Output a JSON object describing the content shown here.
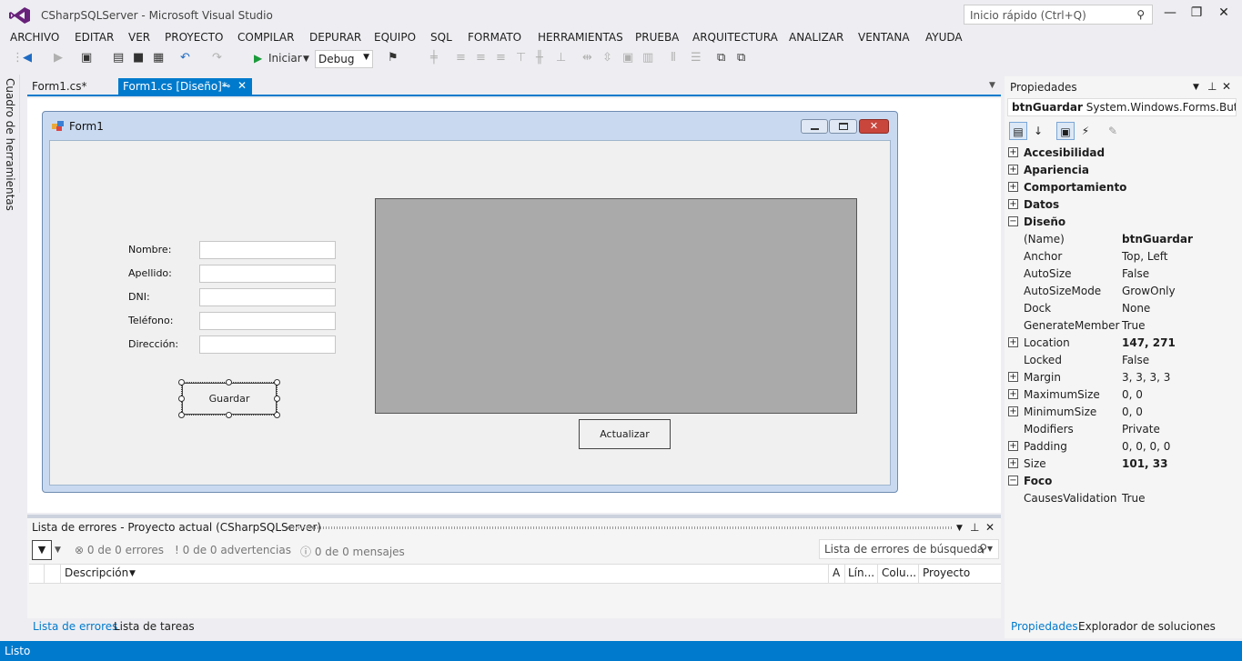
{
  "window": {
    "title": "CSharpSQLServer - Microsoft Visual Studio",
    "quick_launch_placeholder": "Inicio rápido (Ctrl+Q)"
  },
  "menu": [
    "ARCHIVO",
    "EDITAR",
    "VER",
    "PROYECTO",
    "COMPILAR",
    "DEPURAR",
    "EQUIPO",
    "SQL",
    "FORMATO",
    "HERRAMIENTAS",
    "PRUEBA",
    "ARQUITECTURA",
    "ANALIZAR",
    "VENTANA",
    "AYUDA"
  ],
  "toolbar": {
    "start_label": "Iniciar",
    "config": "Debug"
  },
  "toolbox": {
    "label": "Cuadro de herramientas"
  },
  "tabs": [
    {
      "label": "Form1.cs*"
    },
    {
      "label": "Form1.cs [Diseño]*"
    }
  ],
  "form": {
    "title": "Form1",
    "fields": [
      {
        "label": "Nombre:",
        "value": ""
      },
      {
        "label": "Apellido:",
        "value": ""
      },
      {
        "label": "DNI:",
        "value": ""
      },
      {
        "label": "Teléfono:",
        "value": ""
      },
      {
        "label": "Dirección:",
        "value": ""
      }
    ],
    "save_button": "Guardar",
    "refresh_button": "Actualizar"
  },
  "error_list": {
    "title": "Lista de errores - Proyecto actual (CSharpSQLServer)",
    "errors": "0 de 0 errores",
    "warnings": "0 de 0 advertencias",
    "messages": "0 de 0 mensajes",
    "search_placeholder": "Lista de errores de búsqueda",
    "columns": [
      "Descripción",
      "A",
      "Lín...",
      "Colu...",
      "Proyecto"
    ],
    "tabs": [
      "Lista de errores",
      "Lista de tareas"
    ]
  },
  "properties": {
    "title": "Propiedades",
    "object_name": "btnGuardar",
    "object_type": "System.Windows.Forms.Button",
    "rows": [
      {
        "type": "cat",
        "name": "Accesibilidad",
        "sign": "+"
      },
      {
        "type": "cat",
        "name": "Apariencia",
        "sign": "+"
      },
      {
        "type": "cat",
        "name": "Comportamiento",
        "sign": "+"
      },
      {
        "type": "cat",
        "name": "Datos",
        "sign": "+"
      },
      {
        "type": "cat",
        "name": "Diseño",
        "sign": "−"
      },
      {
        "type": "prop",
        "name": "(Name)",
        "value": "btnGuardar",
        "bold": true
      },
      {
        "type": "prop",
        "name": "Anchor",
        "value": "Top, Left"
      },
      {
        "type": "prop",
        "name": "AutoSize",
        "value": "False"
      },
      {
        "type": "prop",
        "name": "AutoSizeMode",
        "value": "GrowOnly"
      },
      {
        "type": "prop",
        "name": "Dock",
        "value": "None"
      },
      {
        "type": "prop",
        "name": "GenerateMember",
        "value": "True"
      },
      {
        "type": "prop",
        "name": "Location",
        "value": "147, 271",
        "bold": true,
        "sign": "+"
      },
      {
        "type": "prop",
        "name": "Locked",
        "value": "False"
      },
      {
        "type": "prop",
        "name": "Margin",
        "value": "3, 3, 3, 3",
        "sign": "+"
      },
      {
        "type": "prop",
        "name": "MaximumSize",
        "value": "0, 0",
        "sign": "+"
      },
      {
        "type": "prop",
        "name": "MinimumSize",
        "value": "0, 0",
        "sign": "+"
      },
      {
        "type": "prop",
        "name": "Modifiers",
        "value": "Private"
      },
      {
        "type": "prop",
        "name": "Padding",
        "value": "0, 0, 0, 0",
        "sign": "+"
      },
      {
        "type": "prop",
        "name": "Size",
        "value": "101, 33",
        "bold": true,
        "sign": "+"
      },
      {
        "type": "cat",
        "name": "Foco",
        "sign": "−"
      },
      {
        "type": "prop",
        "name": "CausesValidation",
        "value": "True"
      }
    ],
    "tabs": [
      "Propiedades",
      "Explorador de soluciones"
    ]
  },
  "status": "Listo"
}
